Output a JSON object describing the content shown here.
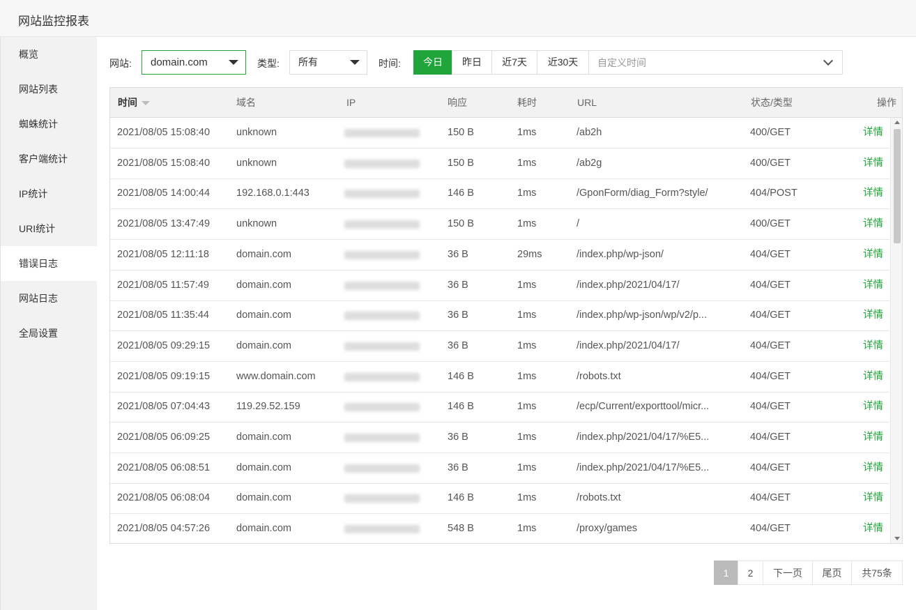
{
  "window": {
    "title": "网站监控报表"
  },
  "sidebar": {
    "items": [
      {
        "label": "概览"
      },
      {
        "label": "网站列表"
      },
      {
        "label": "蜘蛛统计"
      },
      {
        "label": "客户端统计"
      },
      {
        "label": "IP统计"
      },
      {
        "label": "URI统计"
      },
      {
        "label": "错误日志",
        "active": true
      },
      {
        "label": "网站日志"
      },
      {
        "label": "全局设置"
      }
    ]
  },
  "toolbar": {
    "site_label": "网站:",
    "site_value": "domain.com",
    "type_label": "类型:",
    "type_value": "所有",
    "time_label": "时间:",
    "time_buttons": [
      "今日",
      "昨日",
      "近7天",
      "近30天"
    ],
    "time_active": "今日",
    "custom_time_placeholder": "自定义时间"
  },
  "table": {
    "headers": {
      "time": "时间",
      "domain": "域名",
      "ip": "IP",
      "response": "响应",
      "duration": "耗时",
      "url": "URL",
      "status": "状态/类型",
      "action": "操作"
    },
    "detail_label": "详情",
    "rows": [
      {
        "time": "2021/08/05 15:08:40",
        "domain": "unknown",
        "response": "150 B",
        "duration": "1ms",
        "url": "/ab2h",
        "status": "400/GET"
      },
      {
        "time": "2021/08/05 15:08:40",
        "domain": "unknown",
        "response": "150 B",
        "duration": "1ms",
        "url": "/ab2g",
        "status": "400/GET"
      },
      {
        "time": "2021/08/05 14:00:44",
        "domain": "192.168.0.1:443",
        "response": "146 B",
        "duration": "1ms",
        "url": "/GponForm/diag_Form?style/",
        "status": "404/POST"
      },
      {
        "time": "2021/08/05 13:47:49",
        "domain": "unknown",
        "response": "150 B",
        "duration": "1ms",
        "url": "/",
        "status": "400/GET"
      },
      {
        "time": "2021/08/05 12:11:18",
        "domain": "domain.com",
        "response": "36 B",
        "duration": "29ms",
        "url": "/index.php/wp-json/",
        "status": "404/GET"
      },
      {
        "time": "2021/08/05 11:57:49",
        "domain": "domain.com",
        "response": "36 B",
        "duration": "1ms",
        "url": "/index.php/2021/04/17/",
        "status": "404/GET"
      },
      {
        "time": "2021/08/05 11:35:44",
        "domain": "domain.com",
        "response": "36 B",
        "duration": "1ms",
        "url": "/index.php/wp-json/wp/v2/p...",
        "status": "404/GET"
      },
      {
        "time": "2021/08/05 09:29:15",
        "domain": "domain.com",
        "response": "36 B",
        "duration": "1ms",
        "url": "/index.php/2021/04/17/",
        "status": "404/GET"
      },
      {
        "time": "2021/08/05 09:19:15",
        "domain": "www.domain.com",
        "response": "146 B",
        "duration": "1ms",
        "url": "/robots.txt",
        "status": "404/GET"
      },
      {
        "time": "2021/08/05 07:04:43",
        "domain": "119.29.52.159",
        "response": "146 B",
        "duration": "1ms",
        "url": "/ecp/Current/exporttool/micr...",
        "status": "404/GET"
      },
      {
        "time": "2021/08/05 06:09:25",
        "domain": "domain.com",
        "response": "36 B",
        "duration": "1ms",
        "url": "/index.php/2021/04/17/%E5...",
        "status": "404/GET"
      },
      {
        "time": "2021/08/05 06:08:51",
        "domain": "domain.com",
        "response": "36 B",
        "duration": "1ms",
        "url": "/index.php/2021/04/17/%E5...",
        "status": "404/GET"
      },
      {
        "time": "2021/08/05 06:08:04",
        "domain": "domain.com",
        "response": "146 B",
        "duration": "1ms",
        "url": "/robots.txt",
        "status": "404/GET"
      },
      {
        "time": "2021/08/05 04:57:26",
        "domain": "domain.com",
        "response": "548 B",
        "duration": "1ms",
        "url": "/proxy/games",
        "status": "404/GET"
      }
    ]
  },
  "pagination": {
    "pages": [
      "1",
      "2"
    ],
    "current": "1",
    "next_label": "下一页",
    "last_label": "尾页",
    "total_label": "共75条"
  },
  "colors": {
    "accent": "#20a53a",
    "sidebar_bg": "#f2f2f2",
    "header_bg": "#f2f2f2",
    "page_active_bg": "#bbbbbb"
  },
  "icons": {
    "site_dropdown": "caret-down-icon",
    "type_dropdown": "caret-down-icon",
    "custom_time": "chevron-down-icon",
    "sort": "sort-desc-icon"
  }
}
